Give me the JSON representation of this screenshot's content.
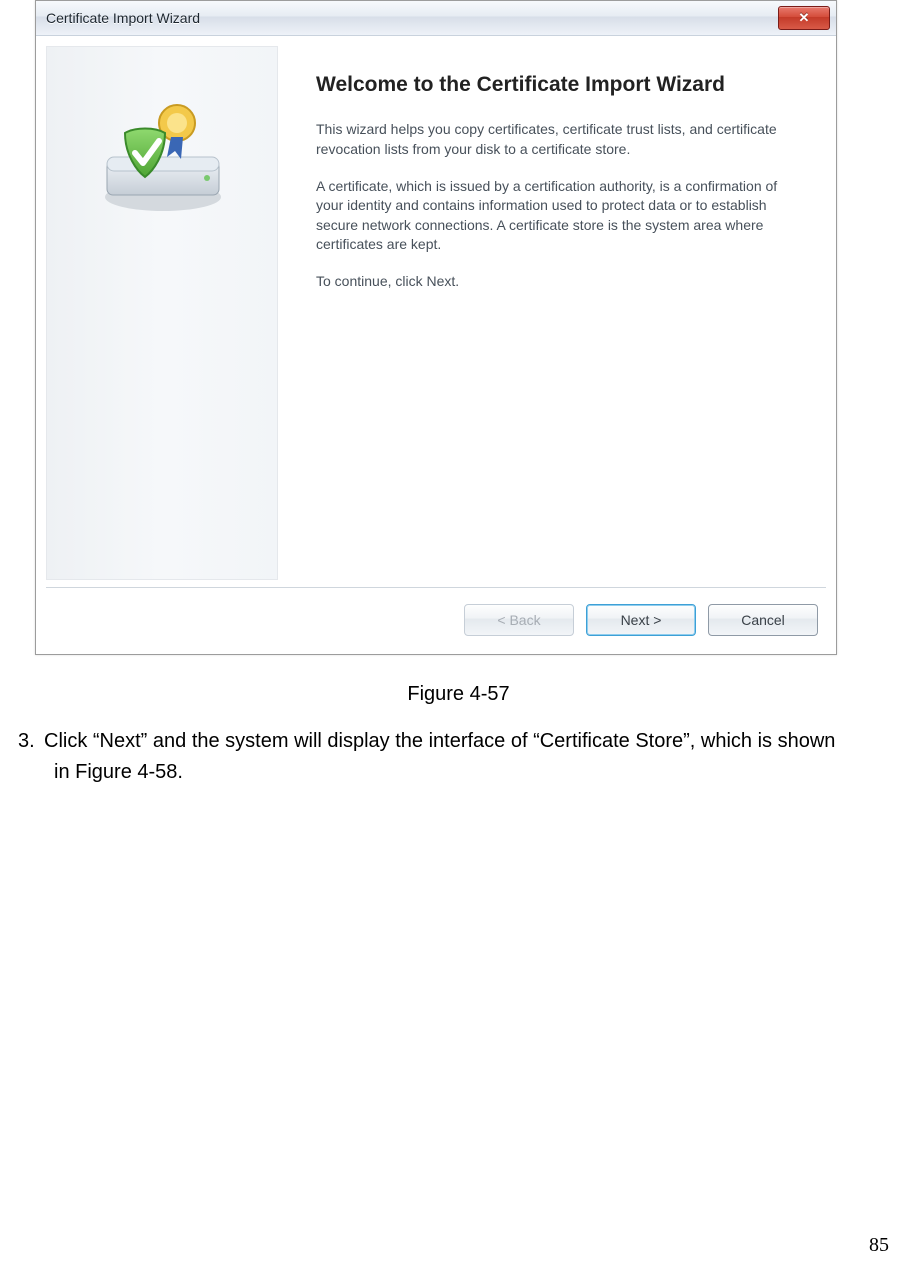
{
  "dialog": {
    "title": "Certificate Import Wizard",
    "heading": "Welcome to the Certificate Import Wizard",
    "para1": "This wizard helps you copy certificates, certificate trust lists, and certificate revocation lists from your disk to a certificate store.",
    "para2": "A certificate, which is issued by a certification authority, is a confirmation of your identity and contains information used to protect data or to establish secure network connections. A certificate store is the system area where certificates are kept.",
    "para3": "To continue, click Next.",
    "buttons": {
      "back": "< Back",
      "next": "Next >",
      "cancel": "Cancel"
    },
    "close_symbol": "✕"
  },
  "caption": "Figure 4-57",
  "step": {
    "number": "3.",
    "text_line1": "Click “Next” and the system will display the interface of “Certificate Store”, which is shown",
    "text_line2": "in Figure 4-58."
  },
  "page_number": "85"
}
